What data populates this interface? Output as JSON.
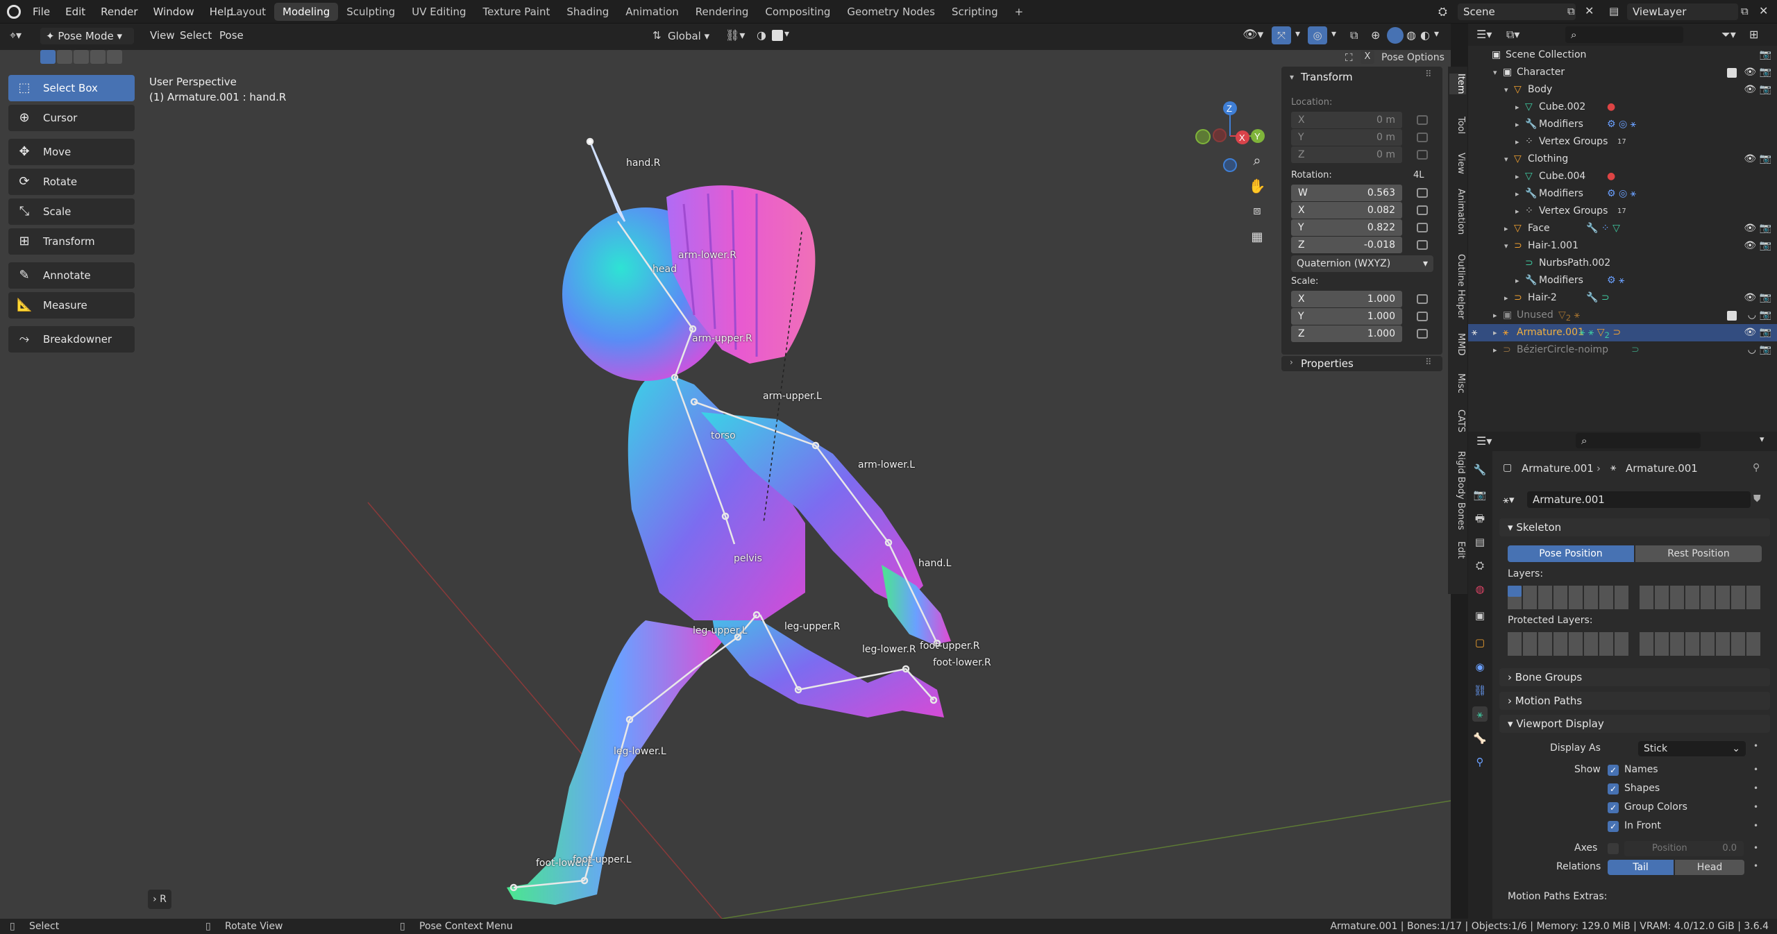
{
  "topbar": {
    "menus": [
      "File",
      "Edit",
      "Render",
      "Window",
      "Help"
    ],
    "workspaces": [
      "Layout",
      "Modeling",
      "Sculpting",
      "UV Editing",
      "Texture Paint",
      "Shading",
      "Animation",
      "Rendering",
      "Compositing",
      "Geometry Nodes",
      "Scripting"
    ],
    "active_workspace": "Modeling",
    "scene": "Scene",
    "view_layer": "ViewLayer"
  },
  "viewport_header": {
    "mode": "Pose Mode",
    "menus": [
      "View",
      "Select",
      "Pose"
    ],
    "orientation": "Global",
    "pose_options": "Pose Options"
  },
  "toolbar": {
    "tools": [
      "Select Box",
      "Cursor",
      "Move",
      "Rotate",
      "Scale",
      "Transform",
      "Annotate",
      "Measure",
      "Breakdowner"
    ],
    "active": "Select Box"
  },
  "viewport": {
    "perspective": "User Perspective",
    "active": "(1) Armature.001 : hand.R",
    "bones": [
      "hand.R",
      "head",
      "arm-lower.R",
      "arm-upper.R",
      "arm-upper.L",
      "torso",
      "arm-lower.L",
      "hand.L",
      "pelvis",
      "leg-upper.L",
      "leg-upper.R",
      "leg-lower.R",
      "foot-upper.R",
      "foot-lower.R",
      "leg-lower.L",
      "foot-lower.L",
      "foot-upper.L"
    ],
    "gizmo": {
      "x": "X",
      "y": "Y",
      "z": "Z"
    },
    "collapsed_label": "R"
  },
  "npanel": {
    "title": "Transform",
    "location_label": "Location:",
    "location": [
      {
        "k": "X",
        "v": "0 m"
      },
      {
        "k": "Y",
        "v": "0 m"
      },
      {
        "k": "Z",
        "v": "0 m"
      }
    ],
    "rotation_label": "Rotation:",
    "rotation_mode_short": "4L",
    "rotation": [
      {
        "k": "W",
        "v": "0.563"
      },
      {
        "k": "X",
        "v": "0.082"
      },
      {
        "k": "Y",
        "v": "0.822"
      },
      {
        "k": "Z",
        "v": "-0.018"
      }
    ],
    "rotation_mode": "Quaternion (WXYZ)",
    "scale_label": "Scale:",
    "scale": [
      {
        "k": "X",
        "v": "1.000"
      },
      {
        "k": "Y",
        "v": "1.000"
      },
      {
        "k": "Z",
        "v": "1.000"
      }
    ],
    "properties": "Properties"
  },
  "side_tabs": [
    "Item",
    "Tool",
    "View",
    "Animation",
    "Outline Helper",
    "MMD",
    "Misc",
    "CATS",
    "Rigid Body Bones",
    "Edit"
  ],
  "outliner": {
    "rows": [
      {
        "label": "Scene Collection"
      },
      {
        "label": "Character"
      },
      {
        "label": "Body"
      },
      {
        "label": "Cube.002"
      },
      {
        "label": "Modifiers"
      },
      {
        "label": "Vertex Groups",
        "count": "17"
      },
      {
        "label": "Clothing"
      },
      {
        "label": "Cube.004"
      },
      {
        "label": "Modifiers"
      },
      {
        "label": "Vertex Groups",
        "count": "17"
      },
      {
        "label": "Face"
      },
      {
        "label": "Hair-1.001"
      },
      {
        "label": "NurbsPath.002"
      },
      {
        "label": "Modifiers"
      },
      {
        "label": "Hair-2"
      },
      {
        "label": "Unused",
        "count": "2"
      },
      {
        "label": "Armature.001",
        "count": "2"
      },
      {
        "label": "BézierCircle-noimp"
      }
    ]
  },
  "properties": {
    "breadcrumb_a": "Armature.001",
    "breadcrumb_b": "Armature.001",
    "data_name": "Armature.001",
    "skeleton": "Skeleton",
    "pose_position": "Pose Position",
    "rest_position": "Rest Position",
    "layers": "Layers:",
    "protected_layers": "Protected Layers:",
    "bone_groups": "Bone Groups",
    "motion_paths": "Motion Paths",
    "viewport_display": "Viewport Display",
    "display_as_label": "Display As",
    "display_as": "Stick",
    "show_label": "Show",
    "names": "Names",
    "shapes": "Shapes",
    "group_colors": "Group Colors",
    "in_front": "In Front",
    "axes_label": "Axes",
    "position_label": "Position",
    "position_value": "0.0",
    "relations_label": "Relations",
    "tail": "Tail",
    "head": "Head",
    "motion_paths_extras": "Motion Paths Extras:"
  },
  "status": {
    "select": "Select",
    "rotate": "Rotate View",
    "context": "Pose Context Menu",
    "info": "Armature.001 | Bones:1/17 | Objects:1/6 | Memory: 129.0 MiB | VRAM: 4.0/12.0 GiB | 3.6.4"
  }
}
